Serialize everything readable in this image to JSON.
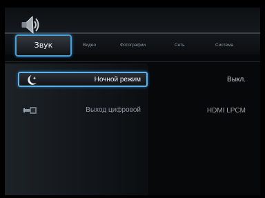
{
  "tabs": {
    "active": {
      "label": "Звук",
      "icon": "speaker-icon"
    },
    "others": [
      "Видео",
      "Фотографии",
      "Сеть",
      "Система"
    ]
  },
  "settings": {
    "rows": [
      {
        "icon": "moon-icon",
        "label": "Ночной режим",
        "value": "Выкл."
      },
      {
        "icon": "digital-output-icon",
        "label": "Выход цифровой",
        "value": "HDMI LPCM"
      }
    ]
  },
  "colors": {
    "accent": "#4aa0d8",
    "background": "#06080a"
  }
}
